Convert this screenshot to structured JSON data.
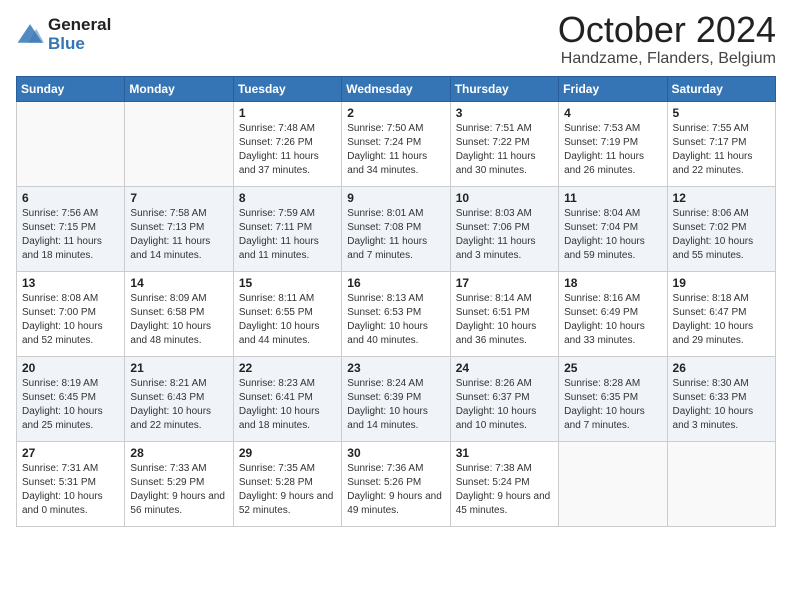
{
  "header": {
    "logo_general": "General",
    "logo_blue": "Blue",
    "month_title": "October 2024",
    "location": "Handzame, Flanders, Belgium"
  },
  "weekdays": [
    "Sunday",
    "Monday",
    "Tuesday",
    "Wednesday",
    "Thursday",
    "Friday",
    "Saturday"
  ],
  "rows": [
    [
      {
        "day": "",
        "text": ""
      },
      {
        "day": "",
        "text": ""
      },
      {
        "day": "1",
        "text": "Sunrise: 7:48 AM\nSunset: 7:26 PM\nDaylight: 11 hours and 37 minutes."
      },
      {
        "day": "2",
        "text": "Sunrise: 7:50 AM\nSunset: 7:24 PM\nDaylight: 11 hours and 34 minutes."
      },
      {
        "day": "3",
        "text": "Sunrise: 7:51 AM\nSunset: 7:22 PM\nDaylight: 11 hours and 30 minutes."
      },
      {
        "day": "4",
        "text": "Sunrise: 7:53 AM\nSunset: 7:19 PM\nDaylight: 11 hours and 26 minutes."
      },
      {
        "day": "5",
        "text": "Sunrise: 7:55 AM\nSunset: 7:17 PM\nDaylight: 11 hours and 22 minutes."
      }
    ],
    [
      {
        "day": "6",
        "text": "Sunrise: 7:56 AM\nSunset: 7:15 PM\nDaylight: 11 hours and 18 minutes."
      },
      {
        "day": "7",
        "text": "Sunrise: 7:58 AM\nSunset: 7:13 PM\nDaylight: 11 hours and 14 minutes."
      },
      {
        "day": "8",
        "text": "Sunrise: 7:59 AM\nSunset: 7:11 PM\nDaylight: 11 hours and 11 minutes."
      },
      {
        "day": "9",
        "text": "Sunrise: 8:01 AM\nSunset: 7:08 PM\nDaylight: 11 hours and 7 minutes."
      },
      {
        "day": "10",
        "text": "Sunrise: 8:03 AM\nSunset: 7:06 PM\nDaylight: 11 hours and 3 minutes."
      },
      {
        "day": "11",
        "text": "Sunrise: 8:04 AM\nSunset: 7:04 PM\nDaylight: 10 hours and 59 minutes."
      },
      {
        "day": "12",
        "text": "Sunrise: 8:06 AM\nSunset: 7:02 PM\nDaylight: 10 hours and 55 minutes."
      }
    ],
    [
      {
        "day": "13",
        "text": "Sunrise: 8:08 AM\nSunset: 7:00 PM\nDaylight: 10 hours and 52 minutes."
      },
      {
        "day": "14",
        "text": "Sunrise: 8:09 AM\nSunset: 6:58 PM\nDaylight: 10 hours and 48 minutes."
      },
      {
        "day": "15",
        "text": "Sunrise: 8:11 AM\nSunset: 6:55 PM\nDaylight: 10 hours and 44 minutes."
      },
      {
        "day": "16",
        "text": "Sunrise: 8:13 AM\nSunset: 6:53 PM\nDaylight: 10 hours and 40 minutes."
      },
      {
        "day": "17",
        "text": "Sunrise: 8:14 AM\nSunset: 6:51 PM\nDaylight: 10 hours and 36 minutes."
      },
      {
        "day": "18",
        "text": "Sunrise: 8:16 AM\nSunset: 6:49 PM\nDaylight: 10 hours and 33 minutes."
      },
      {
        "day": "19",
        "text": "Sunrise: 8:18 AM\nSunset: 6:47 PM\nDaylight: 10 hours and 29 minutes."
      }
    ],
    [
      {
        "day": "20",
        "text": "Sunrise: 8:19 AM\nSunset: 6:45 PM\nDaylight: 10 hours and 25 minutes."
      },
      {
        "day": "21",
        "text": "Sunrise: 8:21 AM\nSunset: 6:43 PM\nDaylight: 10 hours and 22 minutes."
      },
      {
        "day": "22",
        "text": "Sunrise: 8:23 AM\nSunset: 6:41 PM\nDaylight: 10 hours and 18 minutes."
      },
      {
        "day": "23",
        "text": "Sunrise: 8:24 AM\nSunset: 6:39 PM\nDaylight: 10 hours and 14 minutes."
      },
      {
        "day": "24",
        "text": "Sunrise: 8:26 AM\nSunset: 6:37 PM\nDaylight: 10 hours and 10 minutes."
      },
      {
        "day": "25",
        "text": "Sunrise: 8:28 AM\nSunset: 6:35 PM\nDaylight: 10 hours and 7 minutes."
      },
      {
        "day": "26",
        "text": "Sunrise: 8:30 AM\nSunset: 6:33 PM\nDaylight: 10 hours and 3 minutes."
      }
    ],
    [
      {
        "day": "27",
        "text": "Sunrise: 7:31 AM\nSunset: 5:31 PM\nDaylight: 10 hours and 0 minutes."
      },
      {
        "day": "28",
        "text": "Sunrise: 7:33 AM\nSunset: 5:29 PM\nDaylight: 9 hours and 56 minutes."
      },
      {
        "day": "29",
        "text": "Sunrise: 7:35 AM\nSunset: 5:28 PM\nDaylight: 9 hours and 52 minutes."
      },
      {
        "day": "30",
        "text": "Sunrise: 7:36 AM\nSunset: 5:26 PM\nDaylight: 9 hours and 49 minutes."
      },
      {
        "day": "31",
        "text": "Sunrise: 7:38 AM\nSunset: 5:24 PM\nDaylight: 9 hours and 45 minutes."
      },
      {
        "day": "",
        "text": ""
      },
      {
        "day": "",
        "text": ""
      }
    ]
  ]
}
